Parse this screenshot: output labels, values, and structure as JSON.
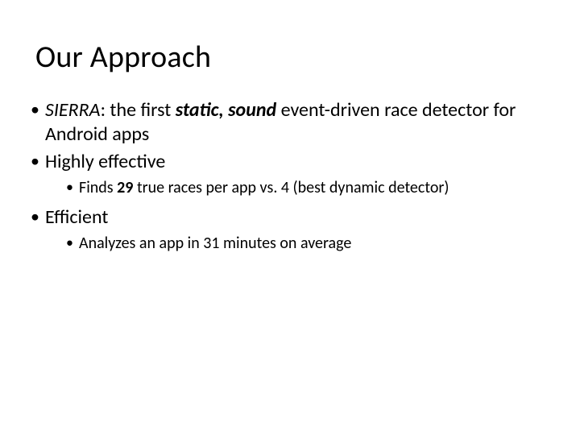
{
  "title": "Our Approach",
  "b1": {
    "seg0": "SIERRA",
    "seg1": ": the first ",
    "seg2": "static, sound",
    "seg3": " event-driven race detector for Android apps"
  },
  "b2": {
    "text": "Highly effective",
    "sub": {
      "seg0": "Finds ",
      "seg1": "29",
      "seg2": " true races per app vs. 4 (best dynamic detector)"
    }
  },
  "b3": {
    "text": "Efficient",
    "sub": "Analyzes an app in 31 minutes on average"
  }
}
